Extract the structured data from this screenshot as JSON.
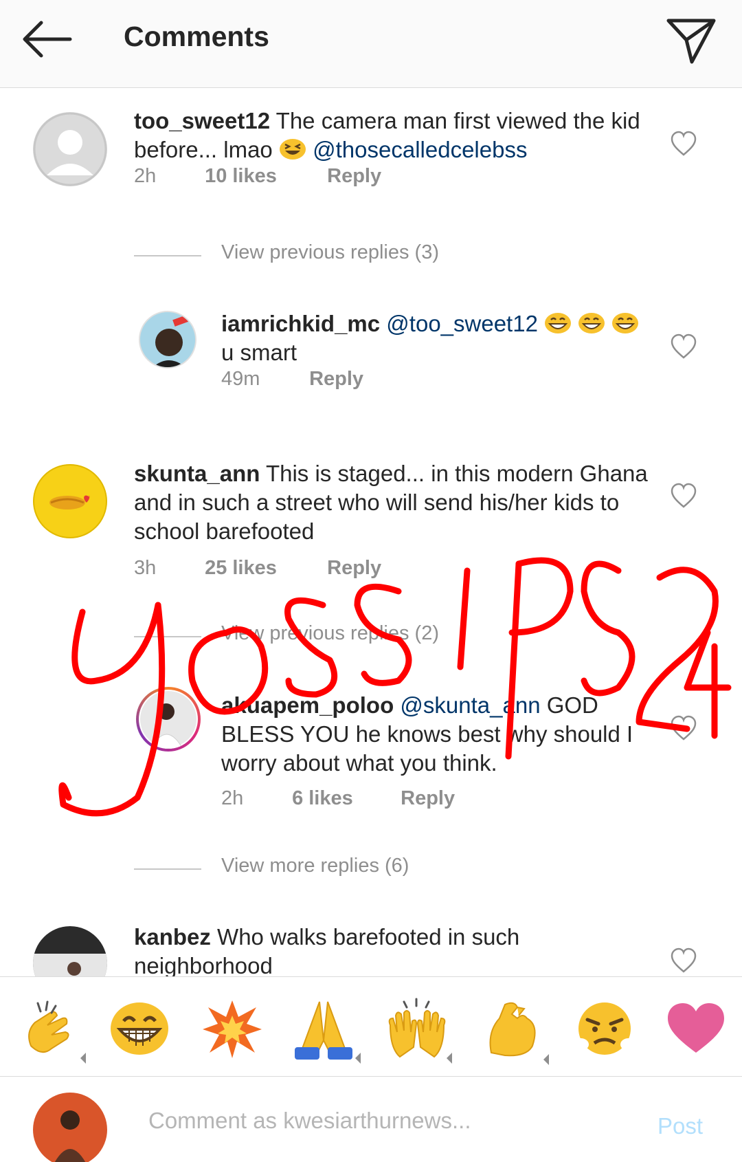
{
  "header": {
    "title": "Comments"
  },
  "comments": [
    {
      "username": "too_sweet12",
      "text": "The camera man first viewed the kid before... lmao",
      "emoji": "grinning-squinting-face",
      "mention": "@thosecalledcelebss",
      "time": "2h",
      "likes": "10 likes",
      "reply": "Reply"
    },
    {
      "username": "iamrichkid_mc",
      "mention": "@too_sweet12",
      "emoji": "grinning-face-with-smiling-eyes",
      "text": "u smart",
      "time": "49m",
      "reply": "Reply"
    },
    {
      "username": "skunta_ann",
      "text": "This is staged... in this modern Ghana and in such a street who will send his/her kids to school barefooted",
      "time": "3h",
      "likes": "25 likes",
      "reply": "Reply"
    },
    {
      "username": "akuapem_poloo",
      "mention": "@skunta_ann",
      "text": "GOD BLESS YOU he knows best why should I worry about what you think.",
      "time": "2h",
      "likes": "6 likes",
      "reply": "Reply"
    },
    {
      "username": "kanbez",
      "text": "Who walks barefooted in such neighborhood"
    }
  ],
  "view_replies": [
    {
      "label": "View previous replies (3)"
    },
    {
      "label": "View previous replies (2)"
    },
    {
      "label": "View more replies (6)"
    }
  ],
  "emoji_bar": [
    "clapping-hands-icon",
    "grinning-face-icon",
    "collision-icon",
    "folded-hands-icon",
    "raising-hands-icon",
    "flexed-biceps-icon",
    "angry-face-icon",
    "pink-heart-icon"
  ],
  "composer": {
    "placeholder": "Comment as kwesiarthurnews...",
    "post_label": "Post"
  },
  "watermark_text": "GOSSIPS24",
  "colors": {
    "mention": "#003569",
    "meta": "#8e8e8e",
    "post_disabled": "#b2dffc",
    "watermark": "#ff0000"
  }
}
